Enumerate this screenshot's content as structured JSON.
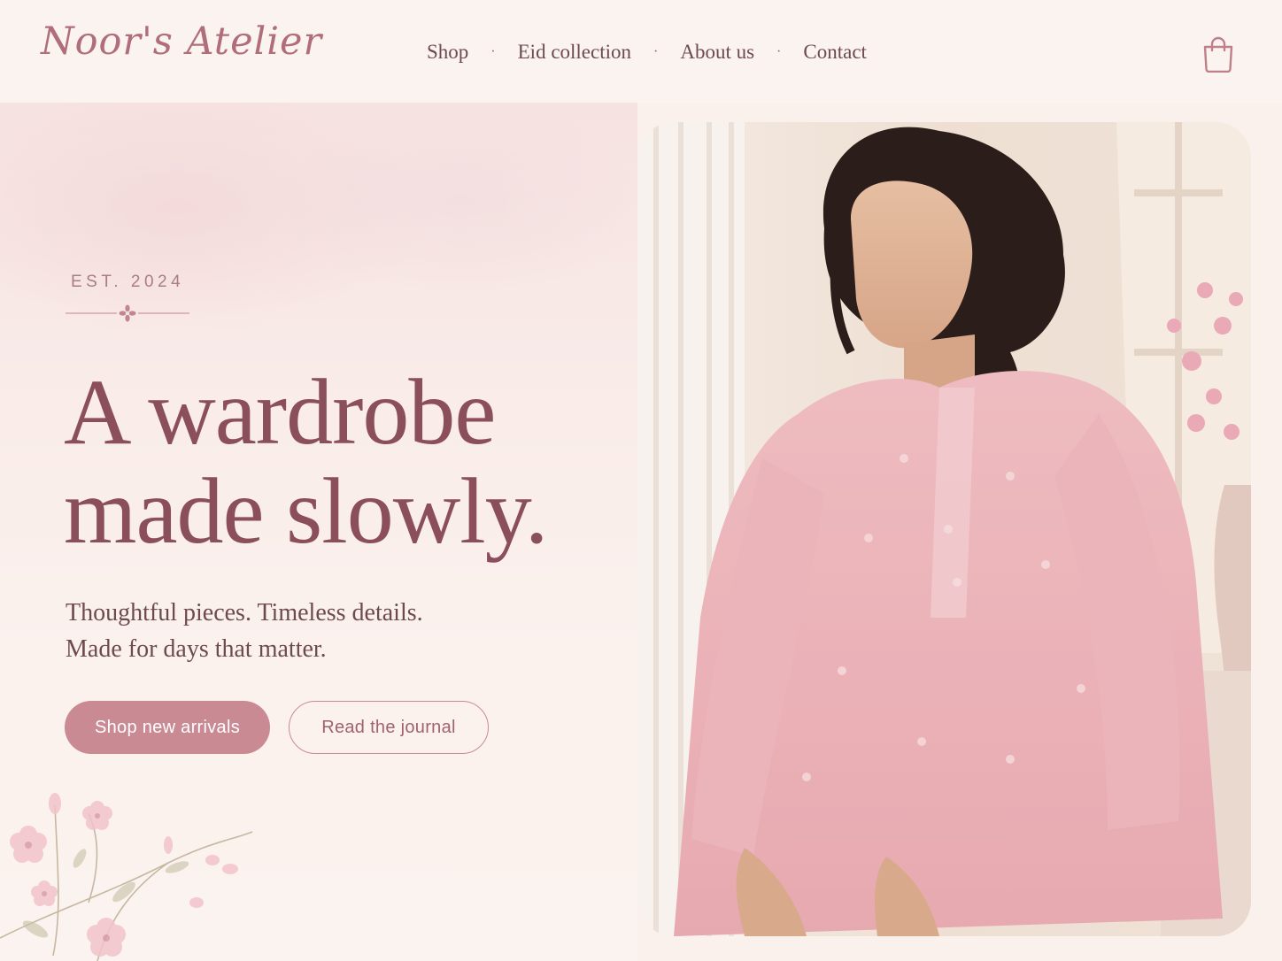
{
  "header": {
    "logo": "Noor's Atelier",
    "nav": [
      {
        "label": "Shop"
      },
      {
        "label": "Eid collection"
      },
      {
        "label": "About us"
      },
      {
        "label": "Contact"
      }
    ],
    "cart_icon": "shopping-bag-icon"
  },
  "hero": {
    "eyebrow": "EST. 2024",
    "headline_line1": "A wardrobe",
    "headline_line2": "made slowly.",
    "subtext_line1": "Thoughtful pieces. Timeless details.",
    "subtext_line2": "Made for days that matter.",
    "primary_button": "Shop new arrivals",
    "secondary_button": "Read the journal",
    "image_description_icon": "model-photo"
  },
  "colors": {
    "background": "#fbf1ec",
    "accent": "#c98a93",
    "headline": "#8a4f5b",
    "text": "#6e4a4f"
  }
}
